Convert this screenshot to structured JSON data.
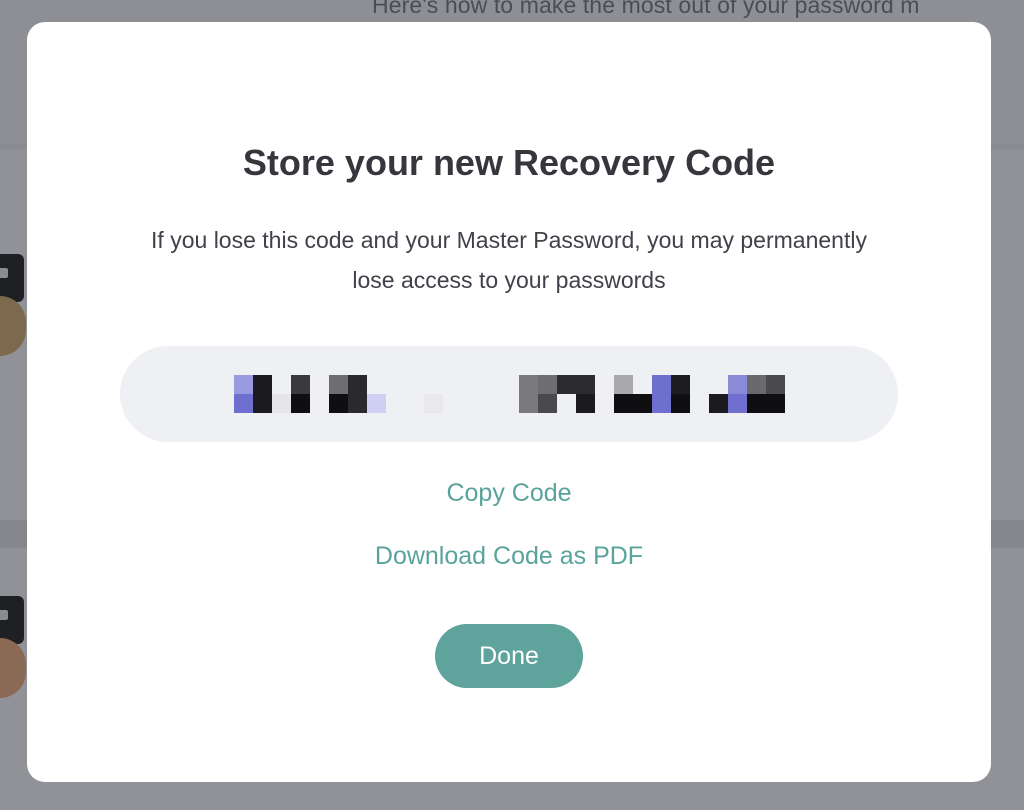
{
  "background": {
    "hint_text": "Here's how to make the most out of your password m"
  },
  "modal": {
    "title": "Store your new Recovery Code",
    "description": "If you lose this code and your Master Password, you may permanently lose access to your passwords",
    "recovery_code_pixels": [
      [
        "#9a9ae0",
        "#1b1b1f",
        "#ffffff",
        "#3a3a3e",
        "#ffffff",
        "#6e6e72",
        "#2a2a2e",
        "#ffffff",
        "#ffffff",
        "#ffffff",
        "#ffffff",
        "#ffffff",
        "#ffffff",
        "#ffffff",
        "#ffffff",
        "#7a7a7e",
        "#6e6e72",
        "#2c2c30",
        "#2c2c30",
        "#ffffff",
        "#a9a9ad",
        "#ffffff",
        "#6f6fcf",
        "#1d1d21",
        "#ffffff",
        "#ffffff",
        "#8a8ad6",
        "#6a6a6e",
        "#4a4a4e"
      ],
      [
        "#6f6fcf",
        "#1b1b1f",
        "#e6e6ea",
        "#0f0f12",
        "#ffffff",
        "#0f0f12",
        "#2a2a2e",
        "#cfcff2",
        "#ffffff",
        "#ffffff",
        "#e9e9ec",
        "#ffffff",
        "#ffffff",
        "#ffffff",
        "#ffffff",
        "#7a7a7e",
        "#4a4a4e",
        "#ffffff",
        "#1b1b1f",
        "#ffffff",
        "#0f0f12",
        "#0f0f12",
        "#6f6fcf",
        "#0f0f12",
        "#ffffff",
        "#1b1b1f",
        "#6f6fcf",
        "#0f0f12",
        "#0f0f12"
      ]
    ],
    "copy_label": "Copy Code",
    "download_label": "Download Code as PDF",
    "done_label": "Done",
    "accent_color": "#5ea39c"
  }
}
